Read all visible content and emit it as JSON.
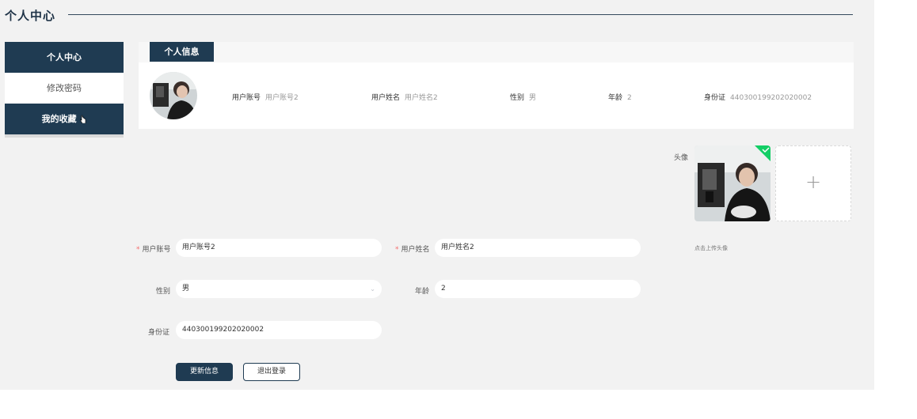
{
  "page_title": "个人中心",
  "sidebar": {
    "items": [
      {
        "label": "个人中心",
        "active": true
      },
      {
        "label": "修改密码",
        "active": false
      },
      {
        "label": "我的收藏",
        "active": true
      }
    ]
  },
  "info_card": {
    "tab_label": "个人信息",
    "fields": [
      {
        "label": "用户账号",
        "value": "用户账号2"
      },
      {
        "label": "用户姓名",
        "value": "用户姓名2"
      },
      {
        "label": "性别",
        "value": "男"
      },
      {
        "label": "年龄",
        "value": "2"
      },
      {
        "label": "身份证",
        "value": "440300199202020002"
      }
    ]
  },
  "upload": {
    "label": "头像",
    "hint": "点击上传头像",
    "add_icon": "plus-icon"
  },
  "form": {
    "account": {
      "label": "用户账号",
      "value": "用户账号2",
      "required": true
    },
    "name": {
      "label": "用户姓名",
      "value": "用户姓名2",
      "required": true
    },
    "gender": {
      "label": "性别",
      "value": "男"
    },
    "age": {
      "label": "年龄",
      "value": "2"
    },
    "idcard": {
      "label": "身份证",
      "value": "440300199202020002"
    }
  },
  "buttons": {
    "update": "更新信息",
    "logout": "退出登录"
  },
  "colors": {
    "primary": "#1f3b52",
    "required": "#f56c6c",
    "success": "#13ce66"
  }
}
